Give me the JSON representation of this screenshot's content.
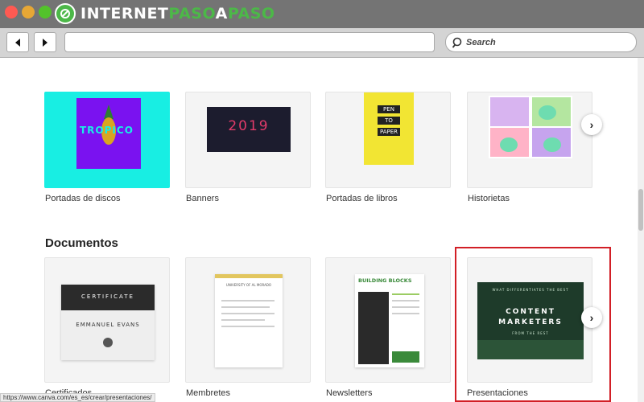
{
  "logo": {
    "part1": "INTERNET",
    "part2": "PASO",
    "part3": "A",
    "part4": "PASO"
  },
  "search": {
    "label": "Search"
  },
  "rows": {
    "row1": [
      {
        "caption": "Portadas de discos",
        "thumb_text": "TROPICO"
      },
      {
        "caption": "Banners",
        "thumb_text": "2019"
      },
      {
        "caption": "Portadas de libros",
        "thumb_lines": [
          "PEN",
          "TO",
          "PAPER"
        ]
      },
      {
        "caption": "Historietas"
      }
    ],
    "section_title": "Documentos",
    "row2": [
      {
        "caption": "Certificados",
        "thumb_heading": "CERTIFICATE",
        "thumb_name": "EMMANUEL EVANS"
      },
      {
        "caption": "Membretes",
        "thumb_heading": "UNIVERSITY OF AL MORADO"
      },
      {
        "caption": "Newsletters",
        "thumb_heading": "BUILDING BLOCKS"
      },
      {
        "caption": "Presentaciones",
        "thumb_kicker": "WHAT DIFFERENTIATES THE BEST",
        "thumb_line1": "CONTENT",
        "thumb_line2": "MARKETERS",
        "thumb_sub": "FROM THE REST"
      }
    ]
  },
  "status_url": "https://www.canva.com/es_es/crear/presentaciones/",
  "colors": {
    "highlight": "#d21f26",
    "brand_green": "#4cb848",
    "tropico_bg": "#18eee3",
    "tropico_inner": "#7a12f0"
  }
}
